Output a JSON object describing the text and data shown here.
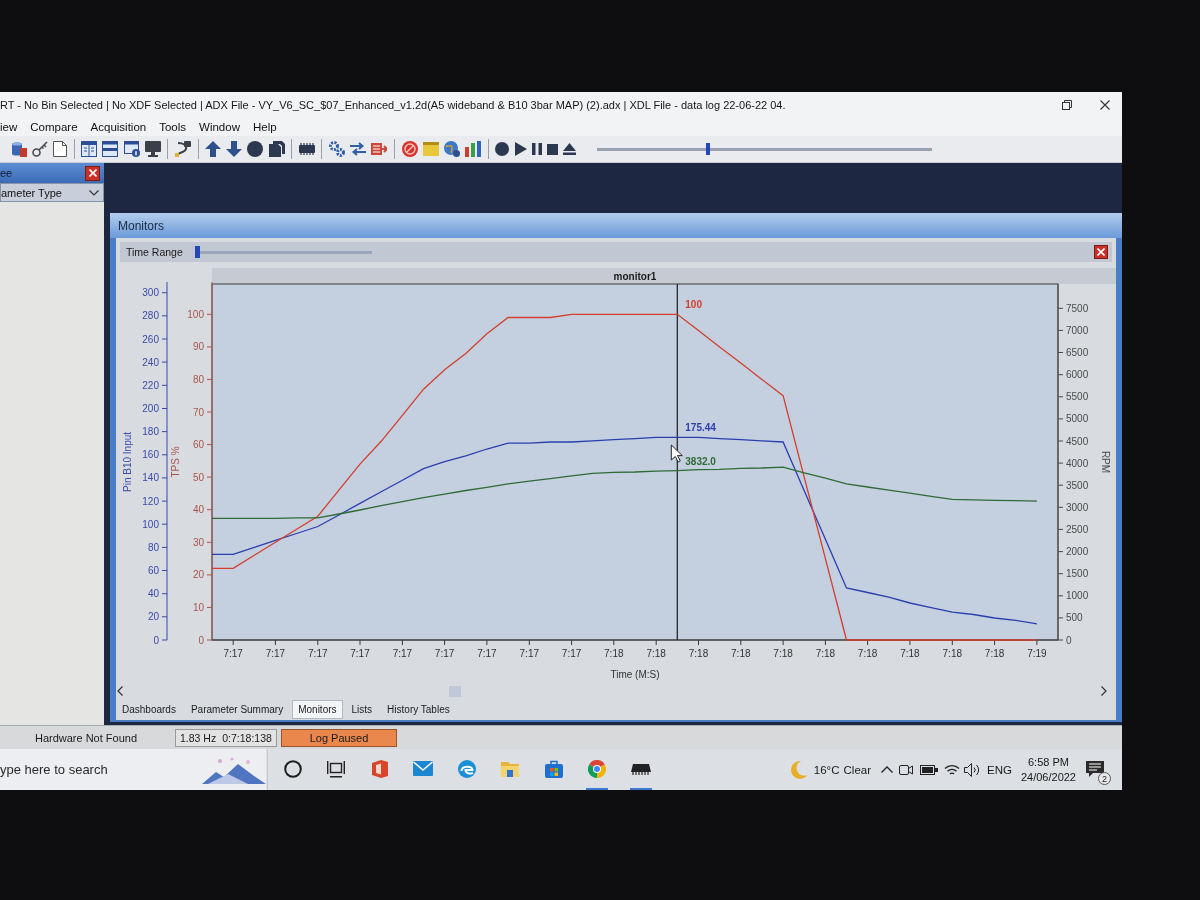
{
  "window": {
    "title": "RT - No Bin Selected | No XDF Selected | ADX File - VY_V6_SC_$07_Enhanced_v1.2d(A5 wideband & B10 3bar MAP) (2).adx | XDL File - data log 22-06-22 04."
  },
  "menu": [
    "iew",
    "Compare",
    "Acquisition",
    "Tools",
    "Window",
    "Help"
  ],
  "toolbar": {
    "position_slider": {
      "level": 0.33
    }
  },
  "side_panel": {
    "title": "ee",
    "dropdown": "ameter Type"
  },
  "monitors": {
    "title": "Monitors",
    "time_range": {
      "label": "Time Range",
      "level": 0
    },
    "chart_data": {
      "type": "line",
      "title": "monitor1",
      "xlabel": "Time (M:S)",
      "categories": [
        null,
        "7:17",
        null,
        "7:17",
        null,
        "7:17",
        null,
        "7:17",
        null,
        "7:17",
        null,
        "7:17",
        null,
        "7:17",
        null,
        "7:17",
        null,
        "7:17",
        null,
        "7:18",
        null,
        "7:18",
        null,
        "7:18",
        null,
        "7:18",
        null,
        "7:18",
        null,
        "7:18",
        null,
        "7:18",
        null,
        "7:18",
        null,
        "7:18",
        null,
        "7:18",
        null,
        "7:19",
        null
      ],
      "ylabel": "Pin B10 Input",
      "ylim": [
        0,
        307.5
      ],
      "yticks": [
        0,
        20,
        40,
        60,
        80,
        100,
        120,
        140,
        160,
        180,
        200,
        220,
        240,
        260,
        280,
        300
      ],
      "y2label": "TPS %",
      "y2lim": [
        0,
        109.3
      ],
      "y2ticks": [
        0,
        10,
        20,
        30,
        40,
        50,
        60,
        70,
        80,
        90,
        100
      ],
      "y3label": "RPM",
      "y3lim": [
        0,
        8050
      ],
      "y3ticks": [
        0,
        500,
        1000,
        1500,
        2000,
        2500,
        3000,
        3500,
        4000,
        4500,
        5000,
        5500,
        6000,
        6500,
        7000,
        7500
      ],
      "series": [
        {
          "color": "#2a3fae",
          "values": [
            74,
            74,
            80,
            86,
            92,
            98,
            108,
            118,
            128,
            138,
            148,
            154,
            159,
            165,
            170,
            170,
            171,
            171,
            172,
            173,
            174,
            175,
            175,
            175,
            174,
            173,
            172,
            171,
            129,
            87,
            45,
            41,
            37,
            32,
            28,
            24,
            22,
            19,
            17,
            14,
            null
          ]
        },
        {
          "color": "#d2402c",
          "axis": "y2",
          "values": [
            22,
            22,
            26,
            30,
            34,
            38,
            46,
            54,
            61,
            69,
            77,
            83,
            88,
            94,
            99,
            99,
            99,
            100,
            100,
            100,
            100,
            100,
            100,
            95,
            90,
            85,
            80,
            75,
            50,
            25,
            0,
            0,
            0,
            0,
            0,
            0,
            0,
            0,
            0,
            0,
            null
          ]
        },
        {
          "color": "#2f6b34",
          "axis": "y3",
          "values": [
            2750,
            2750,
            2750,
            2750,
            2760,
            2760,
            2850,
            2940,
            3040,
            3130,
            3220,
            3300,
            3380,
            3450,
            3530,
            3590,
            3650,
            3710,
            3770,
            3790,
            3800,
            3820,
            3830,
            3850,
            3860,
            3880,
            3890,
            3910,
            3780,
            3660,
            3530,
            3460,
            3390,
            3320,
            3250,
            3180,
            3170,
            3160,
            3150,
            3140,
            null
          ]
        }
      ],
      "annotations": [
        "175.44",
        "100",
        "3832.0"
      ]
    },
    "tabs": [
      {
        "label": "Dashboards",
        "selected": false
      },
      {
        "label": "Parameter Summary",
        "selected": false
      },
      {
        "label": "Monitors",
        "selected": true
      },
      {
        "label": "Lists",
        "selected": false
      },
      {
        "label": "History Tables",
        "selected": false
      }
    ]
  },
  "status_bar": {
    "hardware": "Hardware Not Found",
    "sample_rate": "1.83 Hz",
    "log_time": "0:7:18:138",
    "log_state": "Log Paused"
  },
  "taskbar": {
    "search": {
      "placeholder": "ype here to search"
    },
    "apps": [
      {
        "running": false
      },
      {
        "running": false
      },
      {
        "running": false
      },
      {
        "running": false
      },
      {
        "running": false
      },
      {
        "running": false
      },
      {
        "running": false
      },
      {
        "running": true
      },
      {
        "running": true
      }
    ],
    "weather": {
      "temperature": "16°C",
      "condition": "Clear"
    },
    "language": "ENG",
    "time": "6:58 PM",
    "date": "24/06/2022",
    "notifications": "2"
  }
}
